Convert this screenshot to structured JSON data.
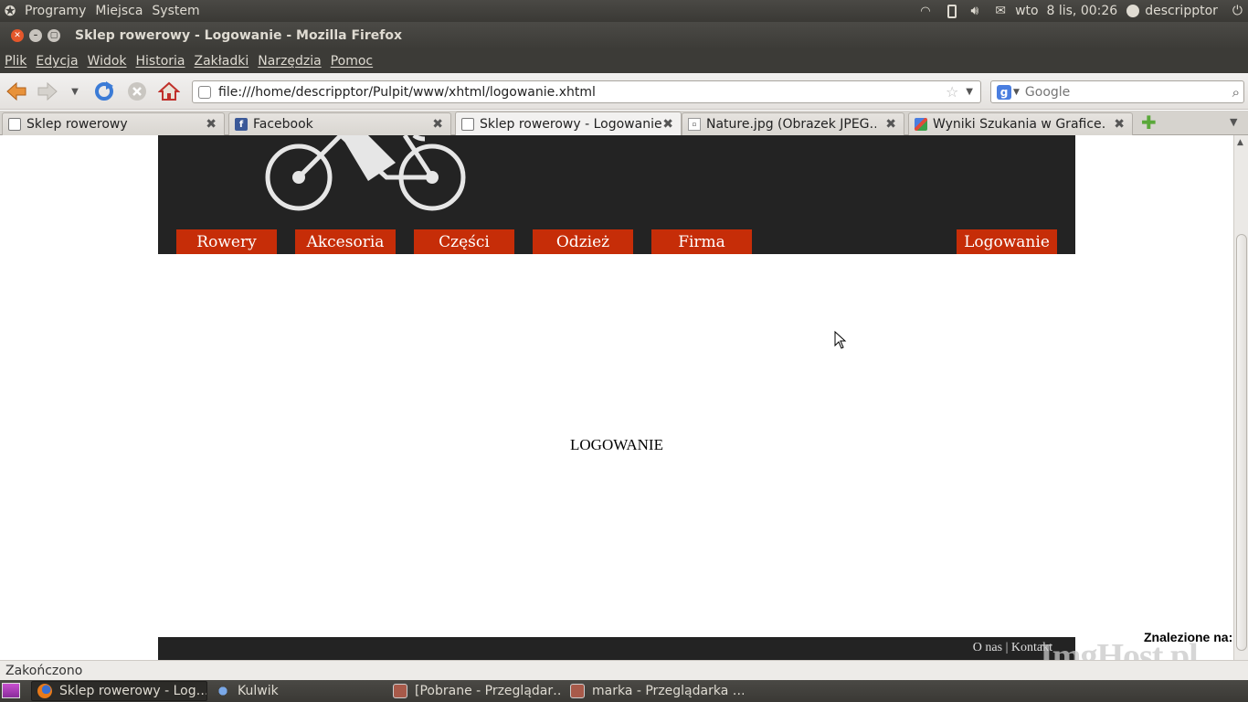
{
  "top_panel": {
    "menus": [
      "Programy",
      "Miejsca",
      "System"
    ],
    "clock": "wto  8 lis, 00:26",
    "user": "descripptor"
  },
  "window": {
    "title": "Sklep rowerowy - Logowanie - Mozilla Firefox"
  },
  "menubar": [
    "Plik",
    "Edycja",
    "Widok",
    "Historia",
    "Zakładki",
    "Narzędzia",
    "Pomoc"
  ],
  "navbar": {
    "url": "file:///home/descripptor/Pulpit/www/xhtml/logowanie.xhtml",
    "search_placeholder": "Google"
  },
  "tabs": [
    {
      "label": "Sklep rowerowy",
      "active": false
    },
    {
      "label": "Facebook",
      "active": false
    },
    {
      "label": "Sklep rowerowy - Logowanie",
      "active": true
    },
    {
      "label": "Nature.jpg (Obrazek JPEG…",
      "active": false
    },
    {
      "label": "Wyniki Szukania w Grafice…",
      "active": false
    }
  ],
  "page": {
    "nav": [
      "Rowery",
      "Akcesoria",
      "Części",
      "Odzież",
      "Firma"
    ],
    "login_button": "Logowanie",
    "heading": "LOGOWANIE",
    "footer_about": "O nas",
    "footer_sep": "|",
    "footer_contact": "Kontakt",
    "found_on": "Znalezione na:",
    "watermark": "ImgHost.pl"
  },
  "status": "Zakończono",
  "taskbar": [
    {
      "label": "Sklep rowerowy - Log…",
      "active": true
    },
    {
      "label": "Kulwik",
      "active": false
    },
    {
      "label": "[Pobrane - Przeglądar…",
      "active": false
    },
    {
      "label": "marka - Przeglądarka …",
      "active": false
    }
  ],
  "colors": {
    "nav_button": "#c62d08",
    "header_bg": "#232323"
  }
}
